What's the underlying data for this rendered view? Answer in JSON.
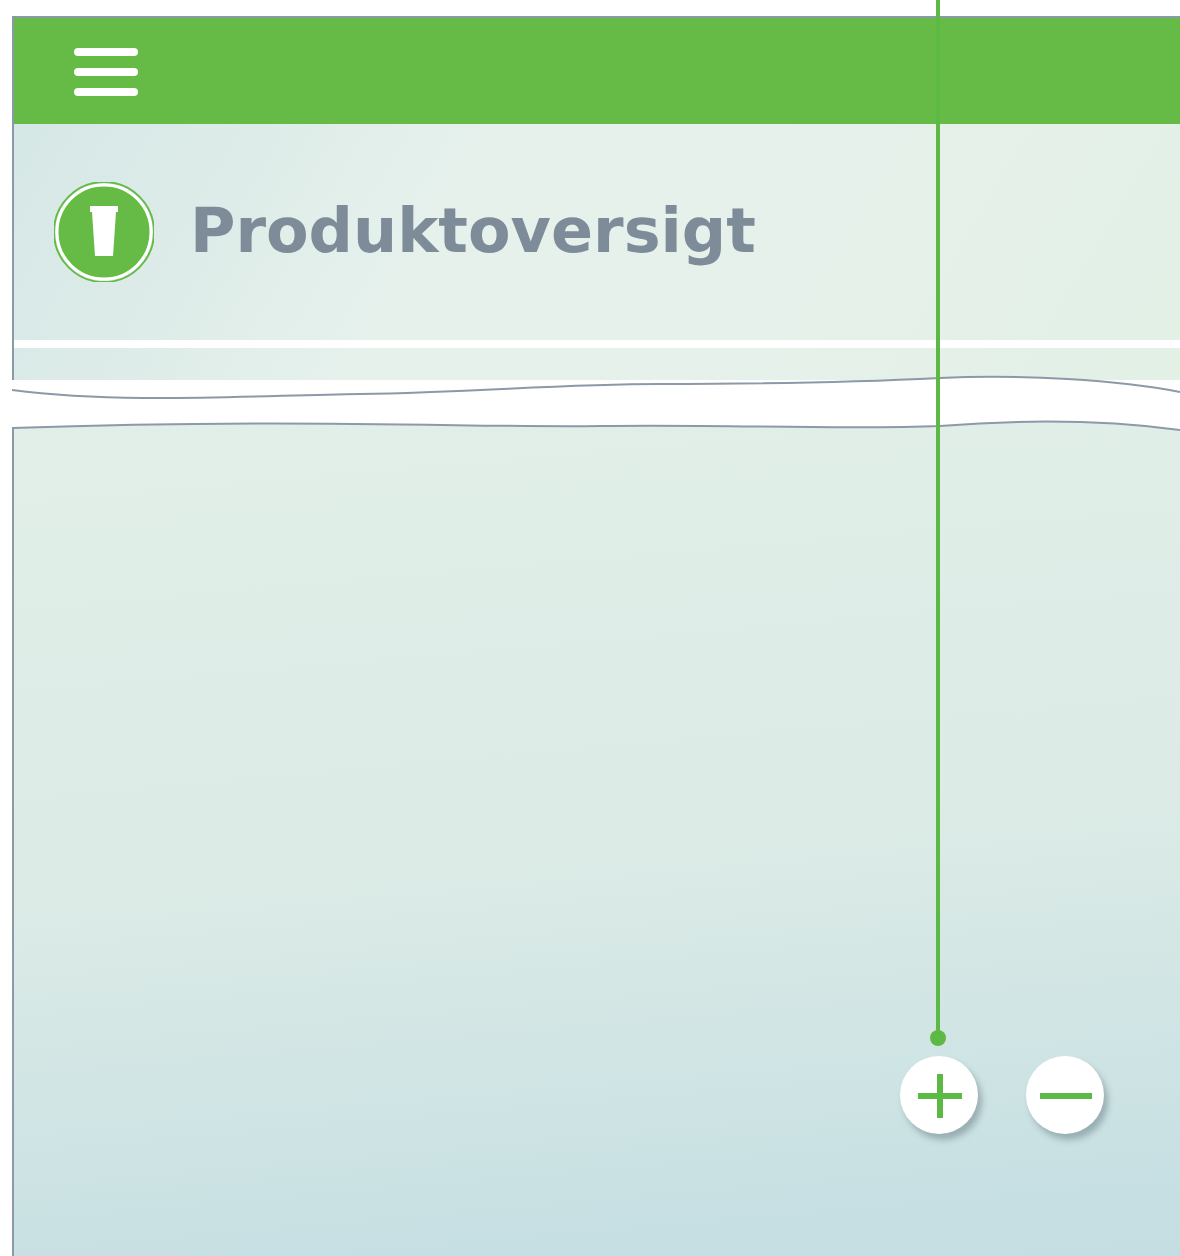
{
  "title": "Produktoversigt"
}
